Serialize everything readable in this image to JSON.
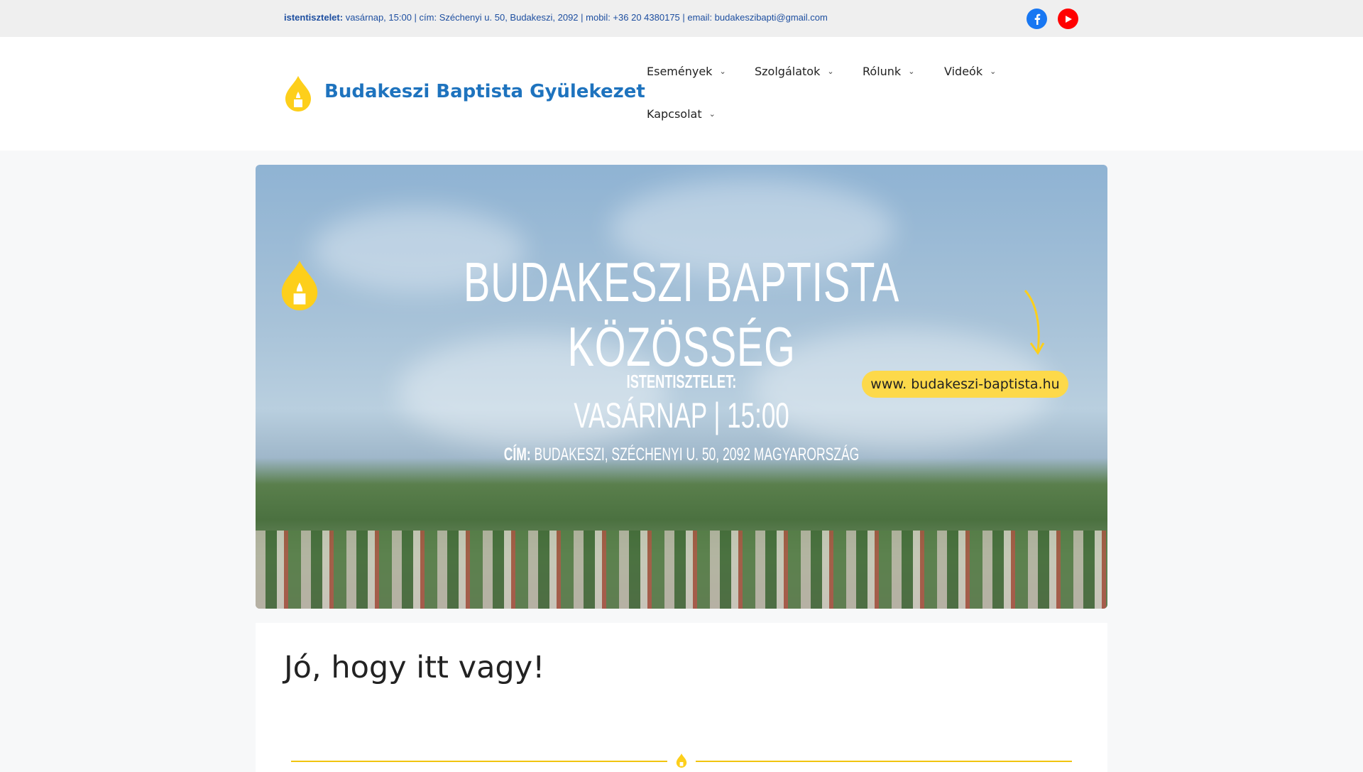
{
  "topbar": {
    "label": "istentisztelet:",
    "info": " vasárnap, 15:00 | cím: Széchenyi u. 50, Budakeszi, 2092 | mobil: +36 20 4380175 | email: budakeszibapti@gmail.com",
    "social": [
      {
        "icon": "facebook-icon",
        "color": "#1877f2"
      },
      {
        "icon": "youtube-icon",
        "color": "#ff0000"
      }
    ]
  },
  "header": {
    "site_title": "Budakeszi Baptista Gyülekezet",
    "nav": [
      {
        "label": "Események"
      },
      {
        "label": "Szolgálatok"
      },
      {
        "label": "Rólunk"
      },
      {
        "label": "Videók"
      },
      {
        "label": "Kapcsolat"
      }
    ]
  },
  "banner": {
    "title": "BUDAKESZI BAPTISTA KÖZÖSSÉG",
    "service_label": "ISTENTISZTELET:",
    "service_time": "VASÁRNAP | 15:00",
    "address_label": "CÍM:",
    "address": " BUDAKESZI, SZÉCHENYI U. 50, 2092 MAGYARORSZÁG",
    "url": "www. budakeszi-baptista.hu"
  },
  "main": {
    "heading": "Jó, hogy itt vagy!"
  },
  "colors": {
    "brand": "#1e73be",
    "accent": "#f1c40f"
  }
}
